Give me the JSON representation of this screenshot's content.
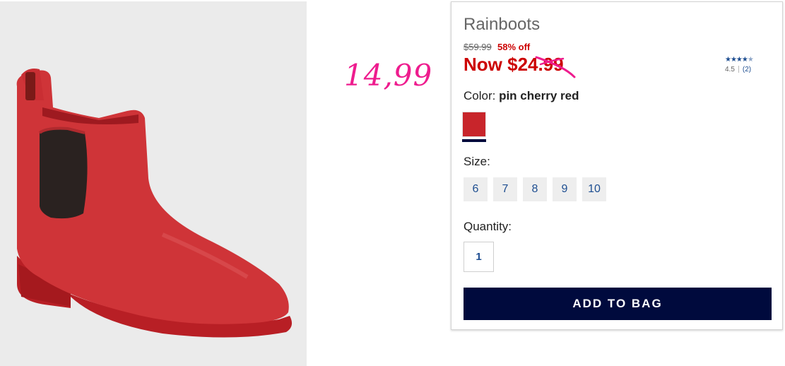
{
  "product": {
    "title": "Rainboots",
    "original_price": "$59.99",
    "discount": "58% off",
    "now_price": "Now $24.99",
    "handwritten_price": "14,99",
    "rating": {
      "stars": "★★★★",
      "stars_half": "★",
      "score": "4.5",
      "count": "(2)",
      "value": 4.5
    },
    "color": {
      "label": "Color: ",
      "value": "pin cherry red",
      "swatch_color": "#c8252b"
    },
    "sizes": {
      "label": "Size:",
      "options": [
        "6",
        "7",
        "8",
        "9",
        "10"
      ]
    },
    "quantity": {
      "label": "Quantity:",
      "value": "1"
    },
    "add_to_bag_label": "ADD TO BAG"
  },
  "colors": {
    "sale_red": "#cc0000",
    "navy": "#000a3d",
    "link_blue": "#1e4e91",
    "annotation_pink": "#ee1c8e"
  }
}
